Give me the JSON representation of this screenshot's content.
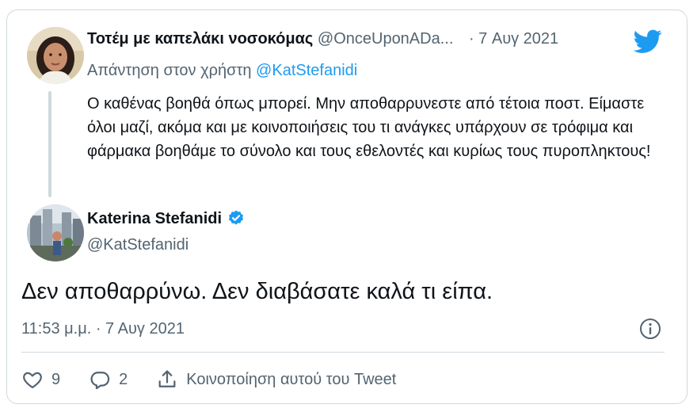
{
  "reply": {
    "display_name": "Τοτέμ με καπελάκι νοσοκόμας",
    "handle": "@OnceUponADa...",
    "date": "· 7 Αυγ 2021",
    "replying_prefix": "Απάντηση στον χρήστη",
    "replying_to": "@KatStefanidi",
    "text": "Ο καθένας βοηθά όπως μπορεί. Μην αποθαρρυνεστε από τέτοια ποστ. Είμαστε όλοι μαζί, ακόμα και με κοινοποιήσεις του τι ανάγκες υπάρχουν σε τρόφιμα και φάρμακα βοηθάμε το σύνολο και τους εθελοντές και κυρίως τους πυροπληκτους!"
  },
  "main": {
    "display_name": "Katerina Stefanidi",
    "handle": "@KatStefanidi",
    "text": "Δεν αποθαρρύνω. Δεν διαβάσατε καλά τι είπα.",
    "timestamp": "11:53 μ.μ. · 7 Αυγ 2021"
  },
  "actions": {
    "likes": "9",
    "replies": "2",
    "share_label": "Κοινοποίηση αυτού του Tweet"
  },
  "icons": [
    "twitter-bird-icon",
    "verified-badge-icon",
    "info-icon",
    "heart-icon",
    "reply-bubble-icon",
    "share-icon"
  ],
  "colors": {
    "accent": "#1d9bf0",
    "text": "#0f1419",
    "muted": "#536471",
    "border": "#cfd9de"
  }
}
